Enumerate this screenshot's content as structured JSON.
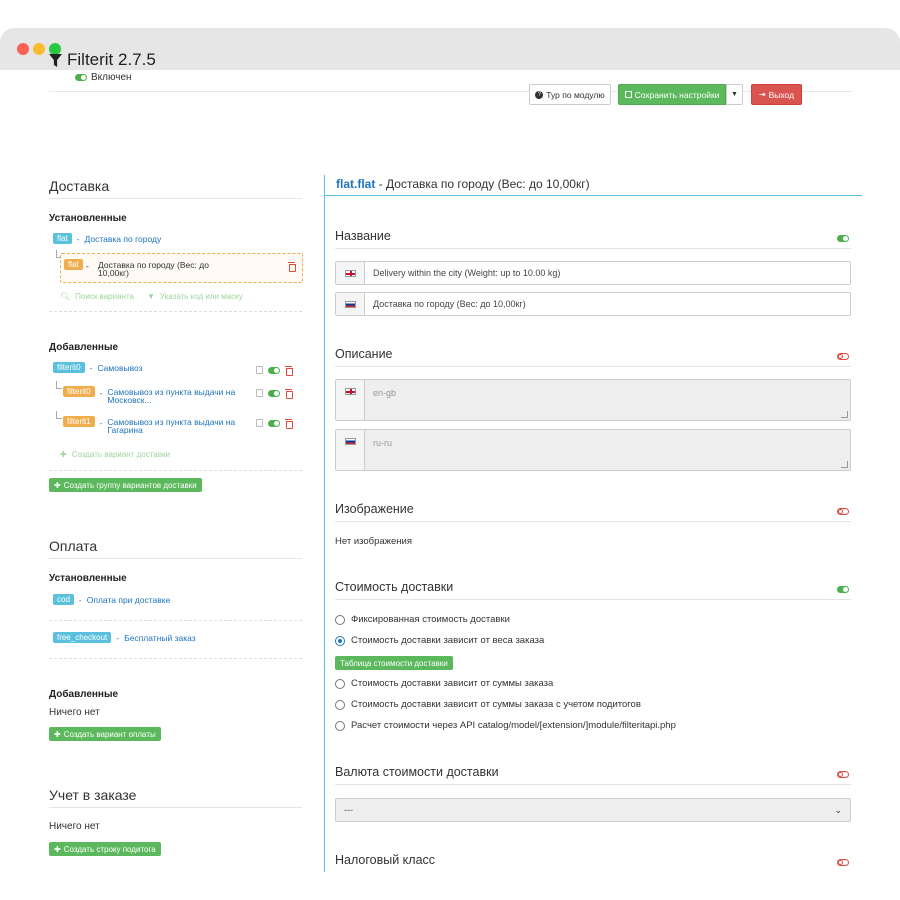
{
  "app": {
    "title": "Filterit 2.7.5",
    "status": "Включен"
  },
  "toolbar": {
    "tour_label": "Тур по модулю",
    "save_label": "Сохранить настройки",
    "exit_label": "Выход"
  },
  "delivery": {
    "title": "Доставка",
    "installed_title": "Установленные",
    "installed": [
      {
        "code": "flat",
        "name": "Доставка по городу"
      }
    ],
    "installed_variant": {
      "code": "flat",
      "name": "Доставка по городу (Вес: до 10,00кг)"
    },
    "search_label": "Поиск варианта",
    "filter_label": "Указать код или маску",
    "added_title": "Добавленные",
    "added": [
      {
        "code": "filterit0",
        "name": "Самовывоз"
      }
    ],
    "added_variants": [
      {
        "code": "filterit0",
        "name": "Самовывоз из пункта выдачи на Московск..."
      },
      {
        "code": "filterit1",
        "name": "Самовывоз из пункта выдачи на Гагарина"
      }
    ],
    "create_variant_label": "Создать вариант доставки",
    "create_group_label": "Создать группу вариантов доставки"
  },
  "payment": {
    "title": "Оплата",
    "installed_title": "Установленные",
    "installed": [
      {
        "code": "cod",
        "name": "Оплата при доставке"
      },
      {
        "code": "free_checkout",
        "name": "Бесплатный заказ"
      }
    ],
    "added_title": "Добавленные",
    "empty_text": "Ничего нет",
    "create_label": "Создать вариант оплаты"
  },
  "order_total": {
    "title": "Учет в заказе",
    "empty_text": "Ничего нет",
    "create_label": "Создать строку подитога"
  },
  "editor": {
    "code": "flat.flat",
    "separator": " - ",
    "title": "Доставка по городу (Вес: до 10,00кг)",
    "name_section": "Название",
    "name_en": "Delivery within the city (Weight: up to 10.00 kg)",
    "name_ru": "Доставка по городу (Вес: до 10,00кг)",
    "description_section": "Описание",
    "desc_en_placeholder": "en-gb",
    "desc_ru_placeholder": "ru-ru",
    "image_section": "Изображение",
    "image_empty": "Нет изображения",
    "cost_section": "Стоимость доставки",
    "cost_options": [
      {
        "label": "Фиксированная стоимость доставки",
        "checked": false
      },
      {
        "label": "Стоимость доставки зависит от веса заказа",
        "checked": true
      },
      {
        "label": "Стоимость доставки зависит от суммы заказа",
        "checked": false
      },
      {
        "label": "Стоимость доставки зависит от суммы заказа с учетом подитогов",
        "checked": false
      },
      {
        "label": "Расчет стоимости через API catalog/model/[extension/]module/filteritapi.php",
        "checked": false
      }
    ],
    "cost_table_label": "Таблица стоимости доставки",
    "currency_section": "Валюта стоимости доставки",
    "currency_value": "---",
    "tax_section": "Налоговый класс"
  },
  "colors": {
    "accent": "#1e73be",
    "success": "#5cb85c",
    "danger": "#d9534f",
    "info": "#5bc0de",
    "warning": "#f0ad4e"
  }
}
